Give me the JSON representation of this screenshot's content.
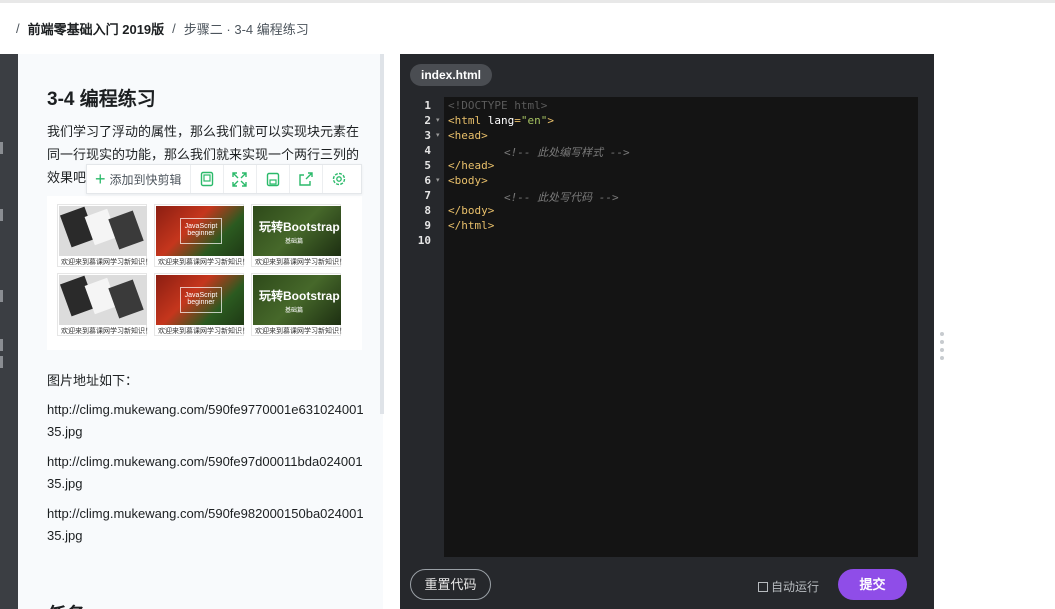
{
  "breadcrumb": {
    "course": "前端零基础入门 2019版",
    "step": "步骤二 · 3-4 编程练习"
  },
  "lesson": {
    "title": "3-4 编程练习",
    "intro": "我们学习了浮动的属性，那么我们就可以实现块元素在同一行现实的功能，那么我们就来实现一个两行三列的效果吧，如",
    "images_label": "图片地址如下：",
    "urls": [
      "http://climg.mukewang.com/590fe9770001e63102400135.jpg",
      "http://climg.mukewang.com/590fe97d00011bda02400135.jpg",
      "http://climg.mukewang.com/590fe982000150ba02400135.jpg"
    ],
    "next_heading": "任务",
    "thumbs": [
      {
        "kind": "desk",
        "caption": "欢迎来到慕课网学习新知识！"
      },
      {
        "kind": "js",
        "caption": "欢迎来到慕课网学习新知识！",
        "t1": "JavaScript",
        "t2": "beginner"
      },
      {
        "kind": "bs",
        "caption": "欢迎来到慕课网学习新知识！",
        "t1": "玩转Bootstrap",
        "t2": "基础篇"
      },
      {
        "kind": "desk",
        "caption": "欢迎来到慕课网学习新知识！"
      },
      {
        "kind": "js",
        "caption": "欢迎来到慕课网学习新知识！",
        "t1": "JavaScript",
        "t2": "beginner"
      },
      {
        "kind": "bs",
        "caption": "欢迎来到慕课网学习新知识！",
        "t1": "玩转Bootstrap",
        "t2": "基础篇"
      }
    ]
  },
  "toolbar": {
    "add_label": "添加到快剪辑",
    "icons": [
      "copy-icon",
      "fullscreen-icon",
      "save-icon",
      "share-icon",
      "settings-icon"
    ]
  },
  "editor": {
    "tab": "index.html",
    "lines": [
      "1",
      "2",
      "3",
      "4",
      "5",
      "6",
      "7",
      "8",
      "9",
      "10"
    ],
    "code": {
      "l1": "!DOCTYPE html>",
      "l2_tag": "<html ",
      "l2_attr": "lang",
      "l2_eq": "=",
      "l2_val": "\"en\"",
      "l2_end": ">",
      "l3": "<head>",
      "l4": "<!-- 此处编写样式 -->",
      "l5": "</head>",
      "l6": "<body>",
      "l7": "<!-- 此处写代码 -->",
      "l8": "</body>",
      "l9": "</html>",
      "l1_prefix": "<"
    },
    "reset_label": "重置代码",
    "autorun_label": "自动运行",
    "submit_label": "提交"
  },
  "colors": {
    "accent": "#8f4de8",
    "editor_bg": "#141414",
    "tag": "#e8bf6a",
    "string": "#a5c261"
  }
}
